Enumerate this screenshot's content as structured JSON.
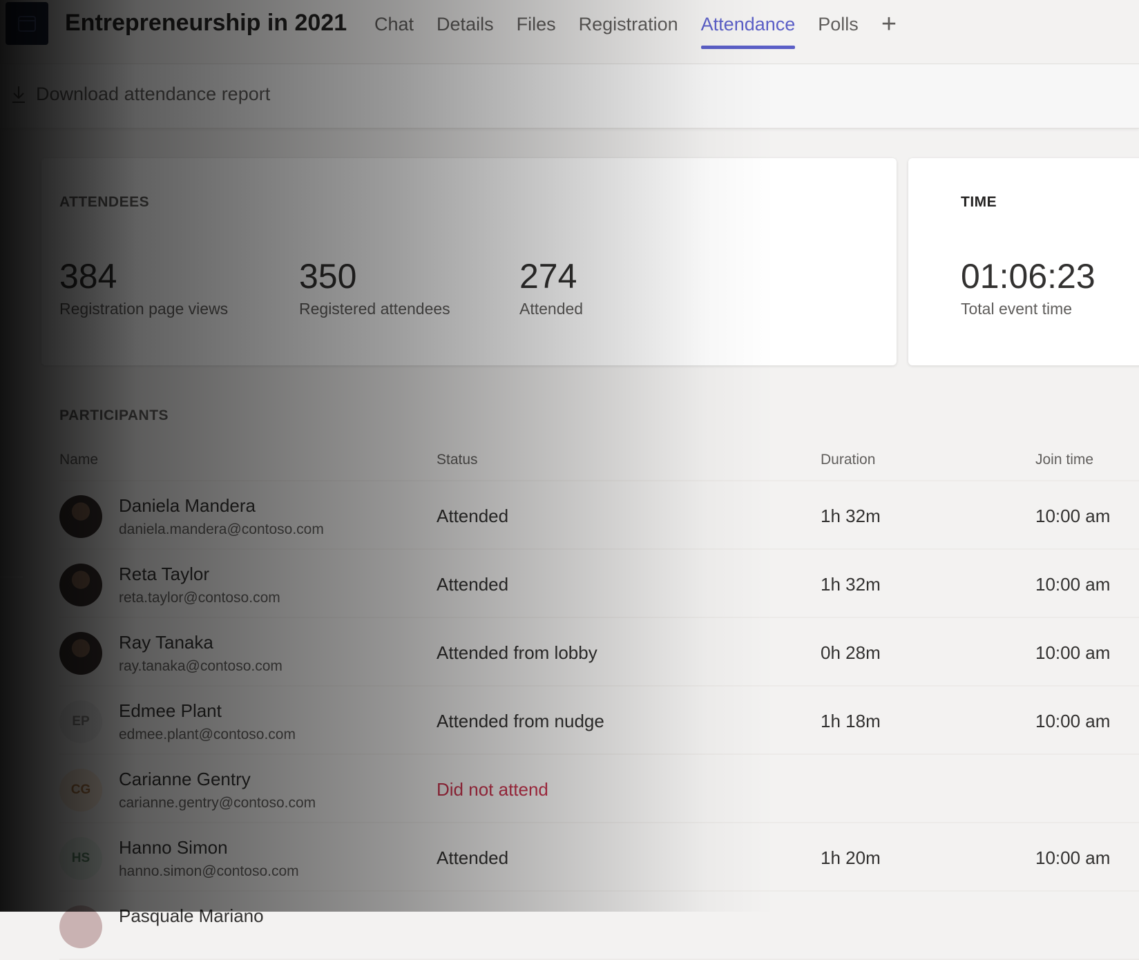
{
  "header": {
    "title": "Entrepreneurship in 2021",
    "tabs": [
      {
        "label": "Chat"
      },
      {
        "label": "Details"
      },
      {
        "label": "Files"
      },
      {
        "label": "Registration"
      },
      {
        "label": "Attendance",
        "active": true
      },
      {
        "label": "Polls"
      }
    ],
    "add_tab_label": "+",
    "accent_color": "#5b5fc7"
  },
  "toolbar": {
    "download_label": "Download attendance report",
    "download_icon": "download-icon"
  },
  "attendees": {
    "heading": "ATTENDEES",
    "stats": [
      {
        "value": "384",
        "label": "Registration page views"
      },
      {
        "value": "350",
        "label": "Registered attendees"
      },
      {
        "value": "274",
        "label": "Attended"
      }
    ]
  },
  "time": {
    "heading": "TIME",
    "value": "01:06:23",
    "label": "Total event time"
  },
  "participants": {
    "heading": "PARTICIPANTS",
    "columns": {
      "name": "Name",
      "status": "Status",
      "duration": "Duration",
      "join_time": "Join time"
    },
    "rows": [
      {
        "name": "Daniela Mandera",
        "email": "daniela.mandera@contoso.com",
        "status": "Attended",
        "duration": "1h 32m",
        "join_time": "10:00 am",
        "initials": ""
      },
      {
        "name": "Reta Taylor",
        "email": "reta.taylor@contoso.com",
        "status": "Attended",
        "duration": "1h 32m",
        "join_time": "10:00 am",
        "initials": ""
      },
      {
        "name": "Ray Tanaka",
        "email": "ray.tanaka@contoso.com",
        "status": "Attended from lobby",
        "duration": "0h 28m",
        "join_time": "10:00 am",
        "initials": ""
      },
      {
        "name": "Edmee Plant",
        "email": "edmee.plant@contoso.com",
        "status": "Attended from nudge",
        "duration": "1h 18m",
        "join_time": "10:00 am",
        "initials": "EP"
      },
      {
        "name": "Carianne Gentry",
        "email": "carianne.gentry@contoso.com",
        "status": "Did not attend",
        "duration": "",
        "join_time": "",
        "initials": "CG"
      },
      {
        "name": "Hanno Simon",
        "email": "hanno.simon@contoso.com",
        "status": "Attended",
        "duration": "1h 20m",
        "join_time": "10:00 am",
        "initials": "HS"
      },
      {
        "name": "Pasquale Mariano",
        "email": "",
        "status": "",
        "duration": "",
        "join_time": "",
        "initials": ""
      }
    ],
    "did_not_attend_color": "#c4314b"
  }
}
